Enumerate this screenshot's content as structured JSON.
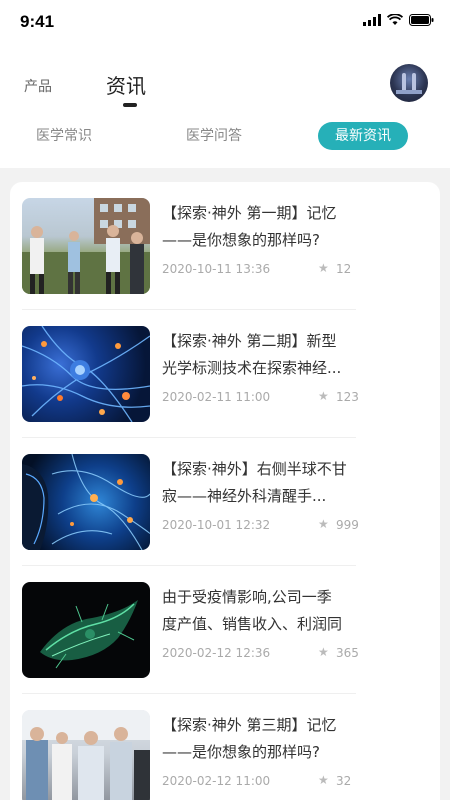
{
  "status_bar": {
    "time": "9:41"
  },
  "nav": {
    "tab_product": "产品",
    "tab_news": "资讯"
  },
  "subtabs": [
    "医学常识",
    "医学问答",
    "最新资讯"
  ],
  "accent_color": "#26b0b8",
  "articles": [
    {
      "title_line1": "【探索·神外 第一期】记忆",
      "title_line2": "——是你想象的那样吗?",
      "date": "2020-10-11 13:36",
      "count": "12",
      "thumb": "people-outdoor"
    },
    {
      "title_line1": "【探索·神外 第二期】新型",
      "title_line2": "光学标测技术在探索神经...",
      "date": "2020-02-11 11:00",
      "count": "123",
      "thumb": "neurons-orange"
    },
    {
      "title_line1": "【探索·神外】右侧半球不甘",
      "title_line2": "寂——神经外科清醒手...",
      "date": "2020-10-01 12:32",
      "count": "999",
      "thumb": "brain-network"
    },
    {
      "title_line1": "由于受疫情影响,公司一季",
      "title_line2": "度产值、销售收入、利润同",
      "date": "2020-02-12 12:36",
      "count": "365",
      "thumb": "green-cell"
    },
    {
      "title_line1": "【探索·神外 第三期】记忆",
      "title_line2": "——是你想象的那样吗?",
      "date": "2020-02-12 11:00",
      "count": "32",
      "thumb": "people-indoor"
    }
  ]
}
